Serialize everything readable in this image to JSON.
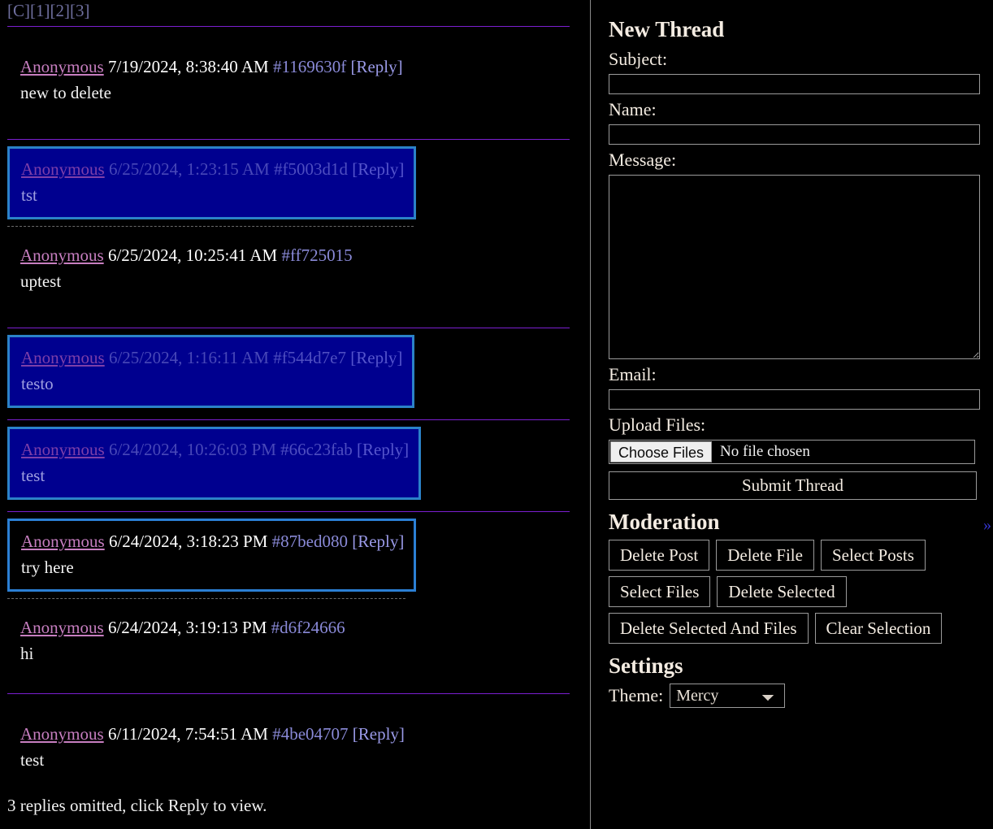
{
  "board": {
    "nav_links": [
      "[C]",
      "[1]",
      "[2]",
      "[3]"
    ]
  },
  "threads": [
    {
      "name": "Anonymous",
      "date": "7/19/2024, 8:38:40 AM",
      "id": "#1169630f",
      "reply_label": "[Reply]",
      "body": "new to delete",
      "state": "plain",
      "has_reply": true
    },
    {
      "name": "Anonymous",
      "date": "6/25/2024, 1:23:15 AM",
      "id": "#f5003d1d",
      "reply_label": "[Reply]",
      "body": "tst",
      "state": "highlight",
      "has_reply": true
    },
    {
      "name": "Anonymous",
      "date": "6/25/2024, 10:25:41 AM",
      "id": "#ff725015",
      "reply_label": "",
      "body": "uptest",
      "state": "plain",
      "has_reply": false
    },
    {
      "name": "Anonymous",
      "date": "6/25/2024, 1:16:11 AM",
      "id": "#f544d7e7",
      "reply_label": "[Reply]",
      "body": "testo",
      "state": "highlight",
      "has_reply": true
    },
    {
      "name": "Anonymous",
      "date": "6/24/2024, 10:26:03 PM",
      "id": "#66c23fab",
      "reply_label": "[Reply]",
      "body": "test",
      "state": "highlight",
      "has_reply": true
    },
    {
      "name": "Anonymous",
      "date": "6/24/2024, 3:18:23 PM",
      "id": "#87bed080",
      "reply_label": "[Reply]",
      "body": "try here",
      "state": "selected",
      "has_reply": true
    },
    {
      "name": "Anonymous",
      "date": "6/24/2024, 3:19:13 PM",
      "id": "#d6f24666",
      "reply_label": "",
      "body": "hi",
      "state": "plain",
      "has_reply": false
    },
    {
      "name": "Anonymous",
      "date": "6/11/2024, 7:54:51 AM",
      "id": "#4be04707",
      "reply_label": "[Reply]",
      "body": "test",
      "state": "plain",
      "has_reply": true
    }
  ],
  "omitted_notice": "3 replies omitted, click Reply to view.",
  "new_thread": {
    "title": "New Thread",
    "subject_label": "Subject:",
    "subject_value": "",
    "name_label": "Name:",
    "name_value": "",
    "message_label": "Message:",
    "message_value": "",
    "email_label": "Email:",
    "email_value": "",
    "upload_label": "Upload Files:",
    "choose_files_label": "Choose Files",
    "file_status": "No file chosen",
    "submit_label": "Submit Thread"
  },
  "moderation": {
    "title": "Moderation",
    "rows": [
      [
        "Delete Post",
        "Delete File",
        "Select Posts"
      ],
      [
        "Select Files",
        "Delete Selected"
      ],
      [
        "Delete Selected And Files",
        "Clear Selection"
      ]
    ]
  },
  "settings": {
    "title": "Settings",
    "theme_label": "Theme:",
    "theme_value": "Mercy",
    "theme_options": [
      "Mercy"
    ]
  },
  "collapse_toggle": {
    "glyph": "»"
  },
  "colors": {
    "background": "#000000",
    "separator_purple": "#7b1fd0",
    "separator_dash": "#6a6a6a",
    "highlight_fill": "#00008f",
    "highlight_border": "#2b82c8",
    "selected_border": "#2b7fd4",
    "name_pink": "#c77ec0",
    "id_blue": "#8a8ad8",
    "reply_blue": "#9a9ae8",
    "nav_link": "#6f6f9e",
    "sidebar_text": "#f4ece2",
    "field_border": "#9a9a9a",
    "toggle_blue": "#3535cf"
  }
}
